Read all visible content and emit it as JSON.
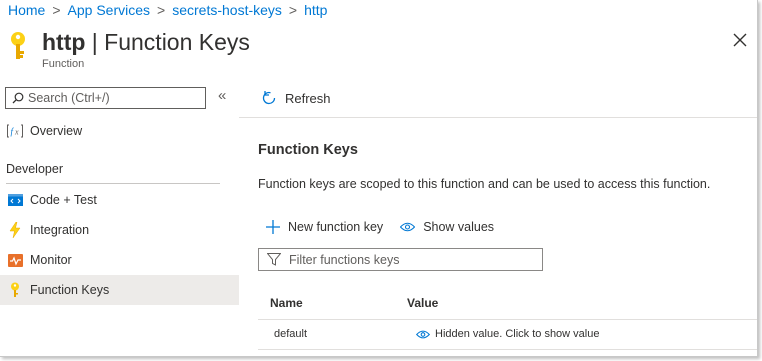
{
  "breadcrumb": {
    "items": [
      "Home",
      "App Services",
      "secrets-host-keys",
      "http"
    ],
    "separator": ">"
  },
  "header": {
    "title_bold": "http",
    "title_rest": " | Function Keys",
    "subtitle": "Function",
    "icon": "key-icon",
    "close_icon": "close-icon"
  },
  "sidebar": {
    "search_placeholder": "Search (Ctrl+/)",
    "collapse_label": "«",
    "overview_label": "Overview",
    "section_label": "Developer",
    "items": [
      {
        "label": "Code + Test",
        "icon": "code-icon"
      },
      {
        "label": "Integration",
        "icon": "lightning-icon"
      },
      {
        "label": "Monitor",
        "icon": "monitor-icon"
      },
      {
        "label": "Function Keys",
        "icon": "key-icon",
        "active": true
      }
    ]
  },
  "toolbar": {
    "refresh_label": "Refresh"
  },
  "main": {
    "section_title": "Function Keys",
    "description": "Function keys are scoped to this function and can be used to access this function.",
    "new_key_label": "New function key",
    "show_values_label": "Show values",
    "filter_placeholder": "Filter functions keys",
    "table": {
      "columns": [
        "Name",
        "Value"
      ],
      "rows": [
        {
          "name": "default",
          "value": "Hidden value. Click to show value"
        }
      ]
    }
  },
  "colors": {
    "accent": "#0078d4",
    "key_yellow": "#fcd116",
    "active_bg": "#edebe9"
  }
}
